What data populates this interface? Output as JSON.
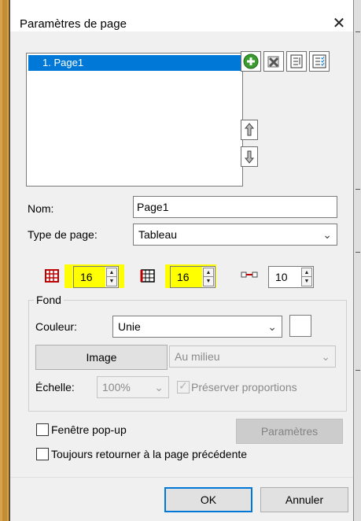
{
  "dialog": {
    "title": "Paramètres de page",
    "close_label": "✕"
  },
  "pages": {
    "items": [
      "1. Page1"
    ]
  },
  "toolbar": {
    "icons": [
      "add-page-icon",
      "delete-page-icon",
      "sort-icon",
      "checklist-icon",
      "move-up-icon",
      "move-down-icon"
    ]
  },
  "form": {
    "name_label": "Nom:",
    "name_value": "Page1",
    "type_label": "Type de page:",
    "type_value": "Tableau"
  },
  "grid": {
    "columns_value": "16",
    "rows_value": "16",
    "spacing_value": "10",
    "highlight_color": "#ffff00"
  },
  "background": {
    "group_title": "Fond",
    "color_label": "Couleur:",
    "color_value": "Unie",
    "image_button": "Image",
    "image_position": "Au milieu",
    "scale_label": "Échelle:",
    "scale_value": "100%",
    "preserve_label": "Préserver proportions"
  },
  "options": {
    "popup_label": "Fenêtre pop-up",
    "return_label": "Toujours retourner à la page précédente",
    "params_button": "Paramètres"
  },
  "footer": {
    "ok_label": "OK",
    "cancel_label": "Annuler"
  },
  "colors": {
    "accent": "#0078d7",
    "frame": "#d8a24a"
  }
}
